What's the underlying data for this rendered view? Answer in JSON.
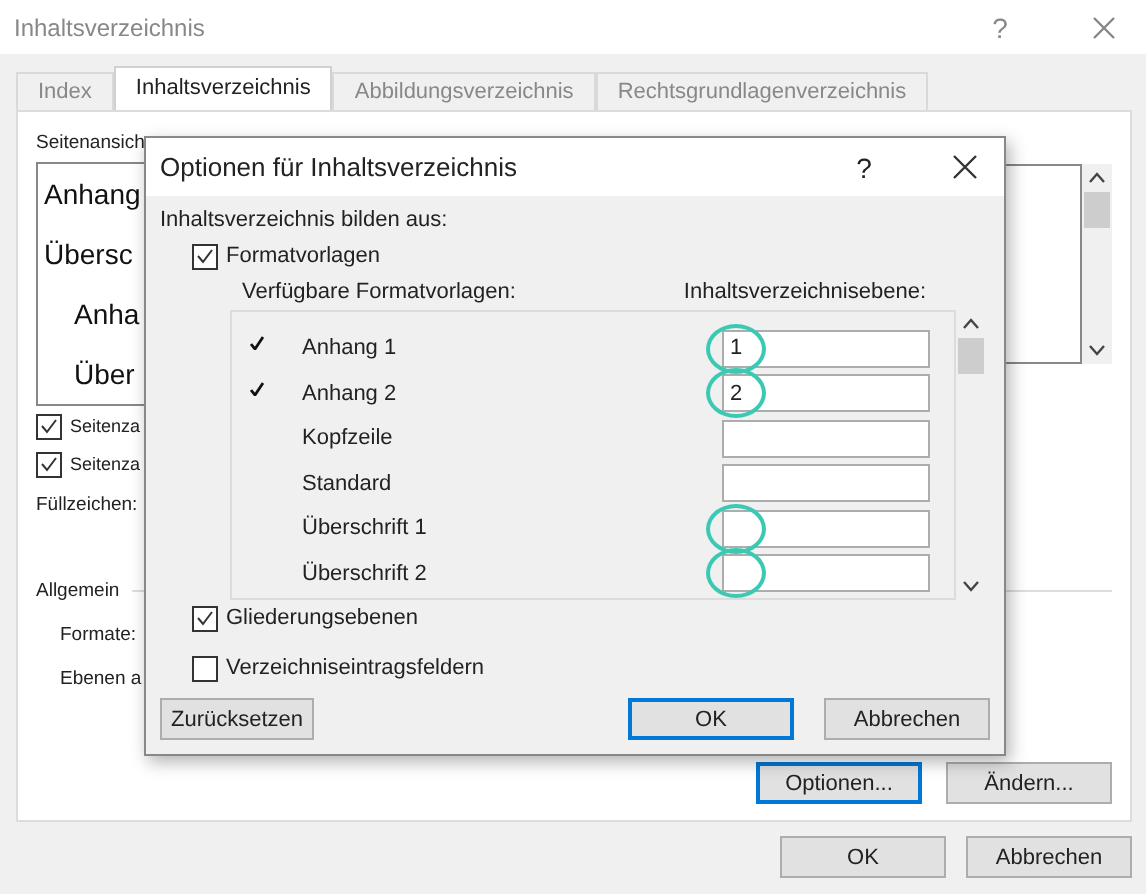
{
  "window": {
    "title": "Inhaltsverzeichnis",
    "help": "?"
  },
  "tabs": [
    {
      "label": "Index",
      "selected": false
    },
    {
      "label": "Inhaltsverzeichnis",
      "selected": true
    },
    {
      "label": "Abbildungsverzeichnis",
      "selected": false
    },
    {
      "label": "Rechtsgrundlagenverzeichnis",
      "selected": false
    }
  ],
  "panel": {
    "preview_label": "Seitenansich",
    "preview_lines": [
      {
        "text": "Anhang",
        "indented": false
      },
      {
        "text": "Übersc",
        "indented": false
      },
      {
        "text": "Anha",
        "indented": true
      },
      {
        "text": "Über",
        "indented": true
      }
    ],
    "checkboxes": [
      {
        "label": "Seitenza",
        "checked": true
      },
      {
        "label": "Seitenza",
        "checked": true
      }
    ],
    "fill_label": "Füllzeichen:",
    "group_label": "Allgemein",
    "fields": [
      {
        "label": "Formate:"
      },
      {
        "label": "Ebenen a"
      }
    ],
    "buttons": [
      {
        "label": "Optionen...",
        "default": true
      },
      {
        "label": "Ändern...",
        "default": false
      }
    ]
  },
  "buttons": [
    {
      "label": "OK",
      "default": false
    },
    {
      "label": "Abbrechen",
      "default": false
    }
  ],
  "options_dialog": {
    "title": "Optionen für Inhaltsverzeichnis",
    "help": "?",
    "build_label": "Inhaltsverzeichnis bilden aus:",
    "styles_checkbox": {
      "label": "Formatvorlagen",
      "checked": true
    },
    "styles_heading": "Verfügbare Formatvorlagen:",
    "level_heading": "Inhaltsverzeichnisebene:",
    "styles": [
      {
        "name": "Anhang 1",
        "checked": true,
        "value": "1",
        "highlighted": true
      },
      {
        "name": "Anhang 2",
        "checked": true,
        "value": "2",
        "highlighted": true
      },
      {
        "name": "Kopfzeile",
        "checked": false,
        "highlighted": false
      },
      {
        "name": "Standard",
        "checked": false,
        "highlighted": false
      },
      {
        "name": "Überschrift 1",
        "checked": false,
        "highlighted": true
      },
      {
        "name": "Überschrift 2",
        "checked": false,
        "highlighted": true
      }
    ],
    "checkboxes": [
      {
        "label": "Gliederungsebenen",
        "checked": true
      },
      {
        "label": "Verzeichniseintragsfeldern",
        "checked": false
      }
    ],
    "buttons": [
      {
        "label": "Zurücksetzen",
        "default": false
      },
      {
        "label": "OK",
        "default": true
      },
      {
        "label": "Abbrechen",
        "default": false
      }
    ]
  }
}
